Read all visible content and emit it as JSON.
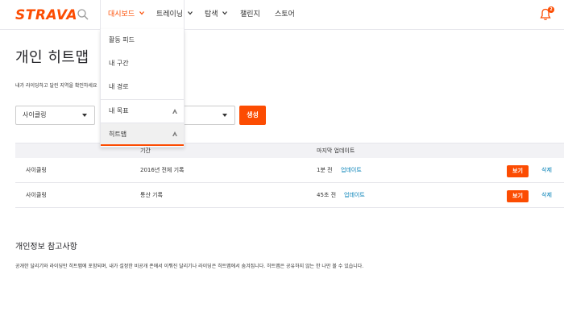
{
  "header": {
    "logo": "STRAVA",
    "nav": [
      {
        "label": "대시보드"
      },
      {
        "label": "트레이닝"
      },
      {
        "label": "탐색"
      },
      {
        "label": "챌린지"
      },
      {
        "label": "스토어"
      }
    ],
    "notification_count": "2",
    "accent_color": "#fc4c02"
  },
  "dropdown": {
    "items": [
      {
        "label": "활동 피드"
      },
      {
        "label": "내 구간"
      },
      {
        "label": "내 경로"
      },
      {
        "label": "내 목표"
      },
      {
        "label": "히트맵"
      }
    ]
  },
  "page": {
    "title": "개인 히트맵",
    "description": "내가 라이딩하고 달린 지역을 확인하세요"
  },
  "controls": {
    "sport_select": "사이클링",
    "generate_label": "생성"
  },
  "table": {
    "headers": [
      "기간",
      "마지막 업데이트"
    ],
    "rows": [
      {
        "sport": "사이클링",
        "period": "2016년 전체 기록",
        "updated": "1분 전",
        "update_link": "업데이트",
        "view": "보기",
        "delete": "삭제"
      },
      {
        "sport": "사이클링",
        "period": "통산 기록",
        "updated": "45초 전",
        "update_link": "업데이트",
        "view": "보기",
        "delete": "삭제"
      }
    ]
  },
  "privacy": {
    "title": "개인정보 참고사항",
    "text": "공개한 달리기와 라이딩만 히트맵에 포함되며, 내가 설정한 비공개 존에서 이뤄진 달리기나 라이딩은 히트맵에서 숨겨집니다. 히트맵은 공유하지 않는 한 나만 볼 수 있습니다."
  }
}
